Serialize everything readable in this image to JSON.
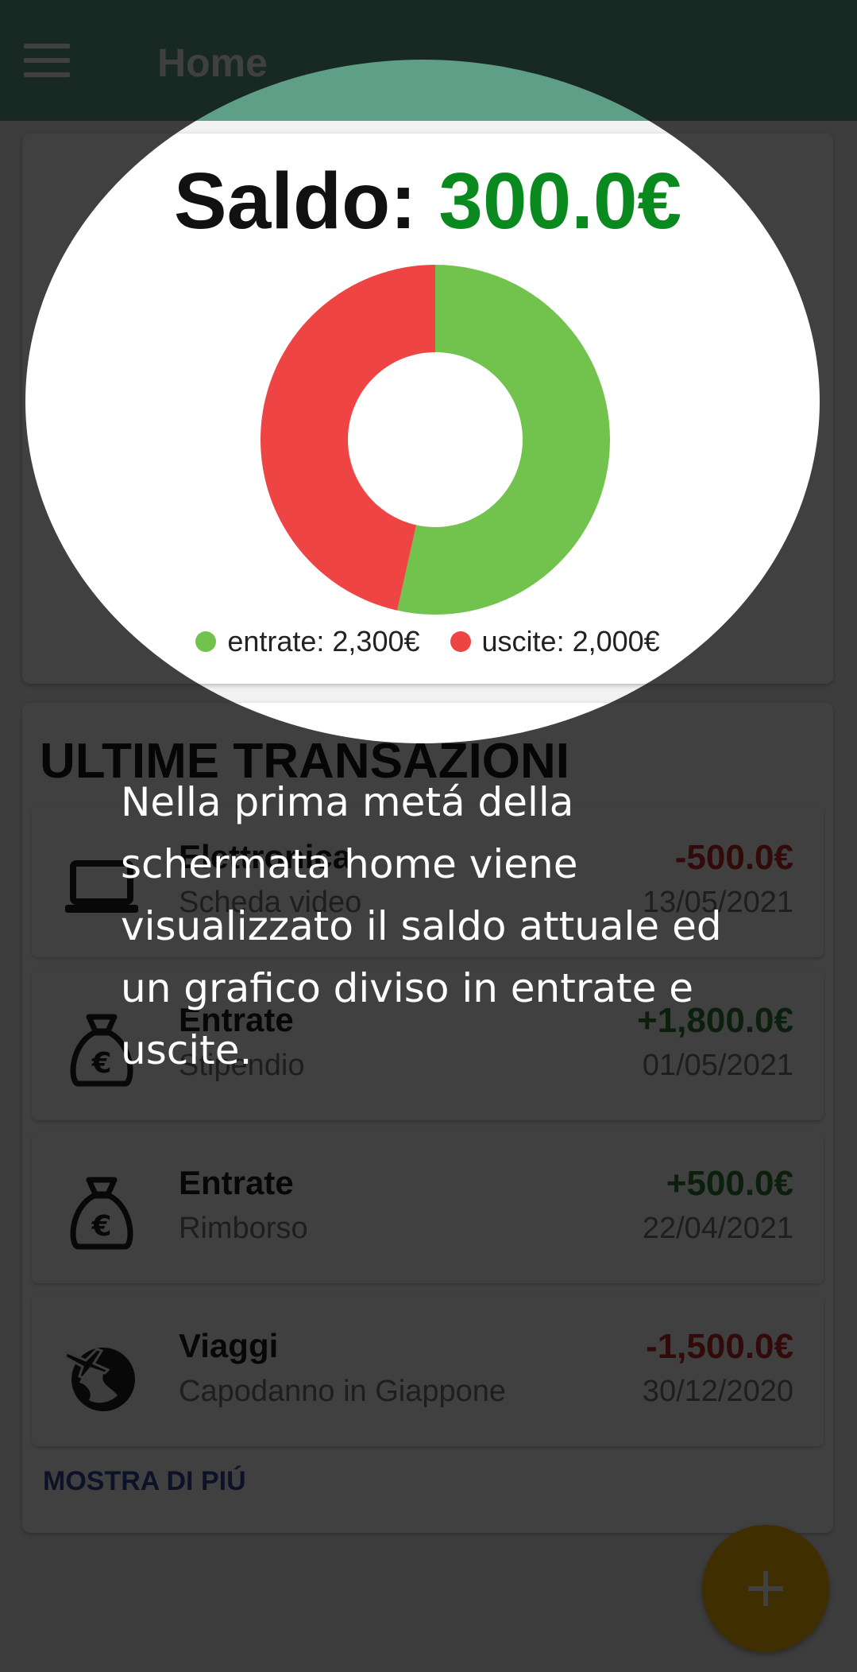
{
  "appbar": {
    "title": "Home",
    "menu_icon": "hamburger-menu-icon"
  },
  "balance": {
    "label": "Saldo: ",
    "value": "300.0€",
    "chart_legend": [
      {
        "label": "entrate: 2,300€",
        "color": "#72c34e"
      },
      {
        "label": "uscite: 2,000€",
        "color": "#ef4444"
      }
    ]
  },
  "chart_data": {
    "type": "pie",
    "categories": [
      "entrate",
      "uscite"
    ],
    "values": [
      2300,
      2000
    ],
    "colors": [
      "#72c34e",
      "#ef4444"
    ],
    "title": "",
    "legend_position": "bottom"
  },
  "transactions": {
    "title": "ULTIME TRANSAZIONI",
    "items": [
      {
        "category": "Elettronica",
        "description": "Scheda video",
        "amount": "-500.0€",
        "date": "13/05/2021",
        "icon": "laptop-icon",
        "sign": "neg"
      },
      {
        "category": "Entrate",
        "description": "Stipendio",
        "amount": "+1,800.0€",
        "date": "01/05/2021",
        "icon": "money-bag-euro-icon",
        "sign": "pos"
      },
      {
        "category": "Entrate",
        "description": "Rimborso",
        "amount": "+500.0€",
        "date": "22/04/2021",
        "icon": "money-bag-euro-icon",
        "sign": "pos"
      },
      {
        "category": "Viaggi",
        "description": "Capodanno in Giappone",
        "amount": "-1,500.0€",
        "date": "30/12/2020",
        "icon": "airplane-globe-icon",
        "sign": "neg"
      }
    ],
    "show_more": "MOSTRA DI PIÚ"
  },
  "fab": {
    "icon": "plus-icon"
  },
  "coach_mark": {
    "text": "Nella prima metá della schermata home viene visualizzato il saldo attuale ed un grafico diviso in entrate e uscite."
  }
}
